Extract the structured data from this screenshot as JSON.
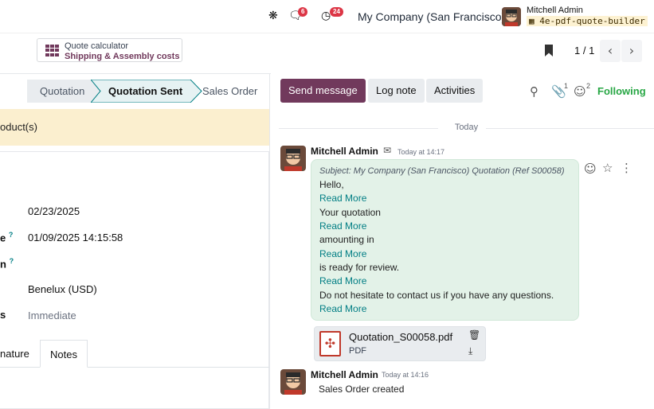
{
  "topbar": {
    "chat_badge": "6",
    "activity_badge": "24",
    "company": "My Company (San Francisco)",
    "user_name": "Mitchell Admin",
    "db_name": "4e-pdf-quote-builder"
  },
  "calculator": {
    "line1": "Quote calculator",
    "line2": "Shipping & Assembly costs"
  },
  "pager": {
    "text": "1 / 1"
  },
  "stages": [
    {
      "label": "Quotation"
    },
    {
      "label": "Quotation Sent"
    },
    {
      "label": "Sales Order"
    }
  ],
  "banner": {
    "text": "oduct(s)"
  },
  "form": {
    "date1": "02/23/2025",
    "date2": "01/09/2025 14:15:58",
    "label_e": "e",
    "label_n": "n",
    "label_s": "s",
    "pricelist": "Benelux (USD)",
    "shipping_policy": "Immediate",
    "tab1": "nature",
    "tab2": "Notes"
  },
  "chatter": {
    "send_message": "Send message",
    "log_note": "Log note",
    "activities": "Activities",
    "attachments_count": "1",
    "followers_count": "2",
    "following": "Following",
    "today": "Today",
    "msg1": {
      "author": "Mitchell Admin",
      "time": "Today at 14:17",
      "subject": "Subject: My Company (San Francisco) Quotation (Ref S00058)",
      "lines": [
        {
          "text": "Hello,",
          "link": false
        },
        {
          "text": "Read More",
          "link": true
        },
        {
          "text": "Your quotation",
          "link": false
        },
        {
          "text": "Read More",
          "link": true
        },
        {
          "text": "amounting in",
          "link": false
        },
        {
          "text": "Read More",
          "link": true
        },
        {
          "text": "is ready for review.",
          "link": false
        },
        {
          "text": "Read More",
          "link": true
        },
        {
          "text": "Do not hesitate to contact us if you have any questions.",
          "link": false
        },
        {
          "text": "Read More",
          "link": true
        }
      ]
    },
    "attachment": {
      "name": "Quotation_S00058.pdf",
      "type": "PDF"
    },
    "msg2": {
      "author": "Mitchell Admin",
      "time": "Today at 14:16",
      "body": "Sales Order created"
    }
  }
}
